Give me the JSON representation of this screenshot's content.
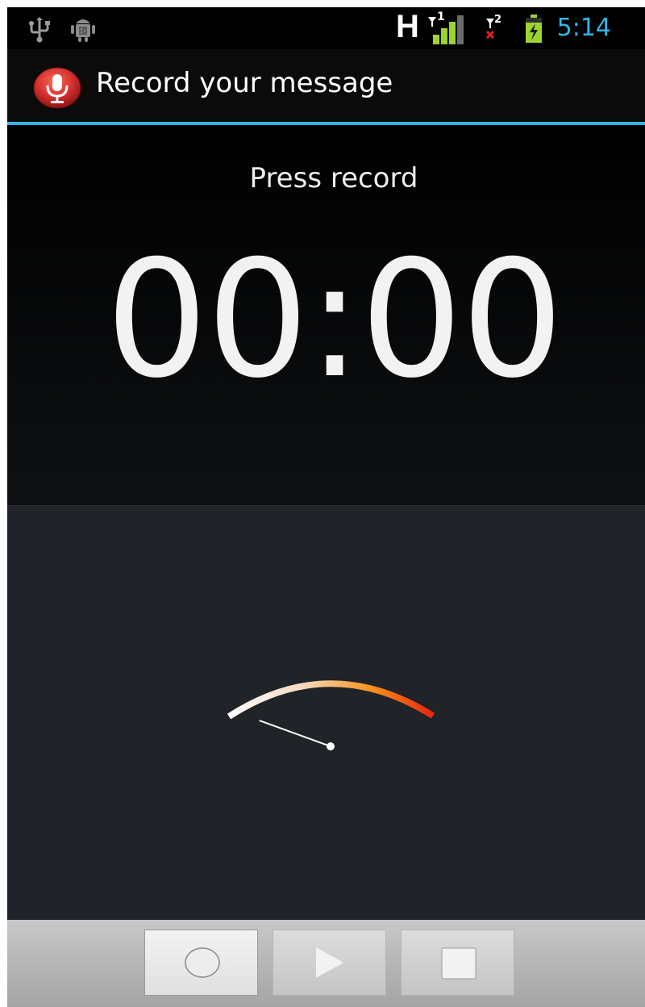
{
  "status_bar": {
    "time": "5:14",
    "network_type": "H",
    "sim1_label": "1",
    "sim2_label": "2",
    "icons": [
      "usb-icon",
      "android-debug-icon",
      "signal-sim1-icon",
      "signal-sim2-no-service-icon",
      "battery-charging-icon"
    ]
  },
  "action_bar": {
    "title": "Record your message",
    "app_icon": "microphone-icon"
  },
  "recorder": {
    "state_message": "Press record",
    "timer": "00:00"
  },
  "vu_meter": {
    "level": 0
  },
  "controls": {
    "buttons": [
      {
        "name": "record",
        "icon": "record-icon",
        "active": true
      },
      {
        "name": "play",
        "icon": "play-icon",
        "active": false
      },
      {
        "name": "stop",
        "icon": "stop-icon",
        "active": false
      }
    ]
  },
  "colors": {
    "accent": "#33b5e5",
    "record_red": "#d32f2f",
    "meter_orange": "#f7931e",
    "meter_red": "#e8250c"
  }
}
